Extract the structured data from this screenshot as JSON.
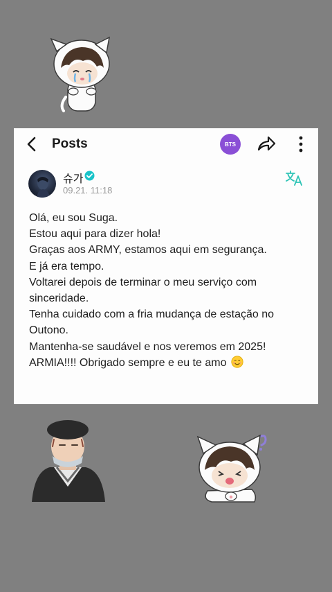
{
  "header": {
    "title": "Posts",
    "badge_label": "BTS",
    "badge_color": "#8a4fd6",
    "back_icon": "chevron-left-icon",
    "share_icon": "share-arrow-icon",
    "more_icon": "more-vertical-icon"
  },
  "post": {
    "author": "슈가",
    "verified": true,
    "timestamp": "09.21. 11:18",
    "translate_icon": "translate-icon",
    "translate_color": "#2ec4b6",
    "lines": [
      "Olá, eu sou Suga.",
      "Estou aqui para dizer hola!",
      "Graças aos ARMY, estamos aqui em segurança.",
      "E já era tempo.",
      "Voltarei depois de terminar o meu serviço com",
      "sinceridade.",
      "Tenha cuidado com a fria mudança de estação no",
      "Outono.",
      "Mantenha-se saudável e nos veremos em 2025!",
      "ARMIA!!!! Obrigado sempre e eu te amo"
    ],
    "closing_emoji": "smiling-face-icon"
  },
  "background_color": "#808080"
}
